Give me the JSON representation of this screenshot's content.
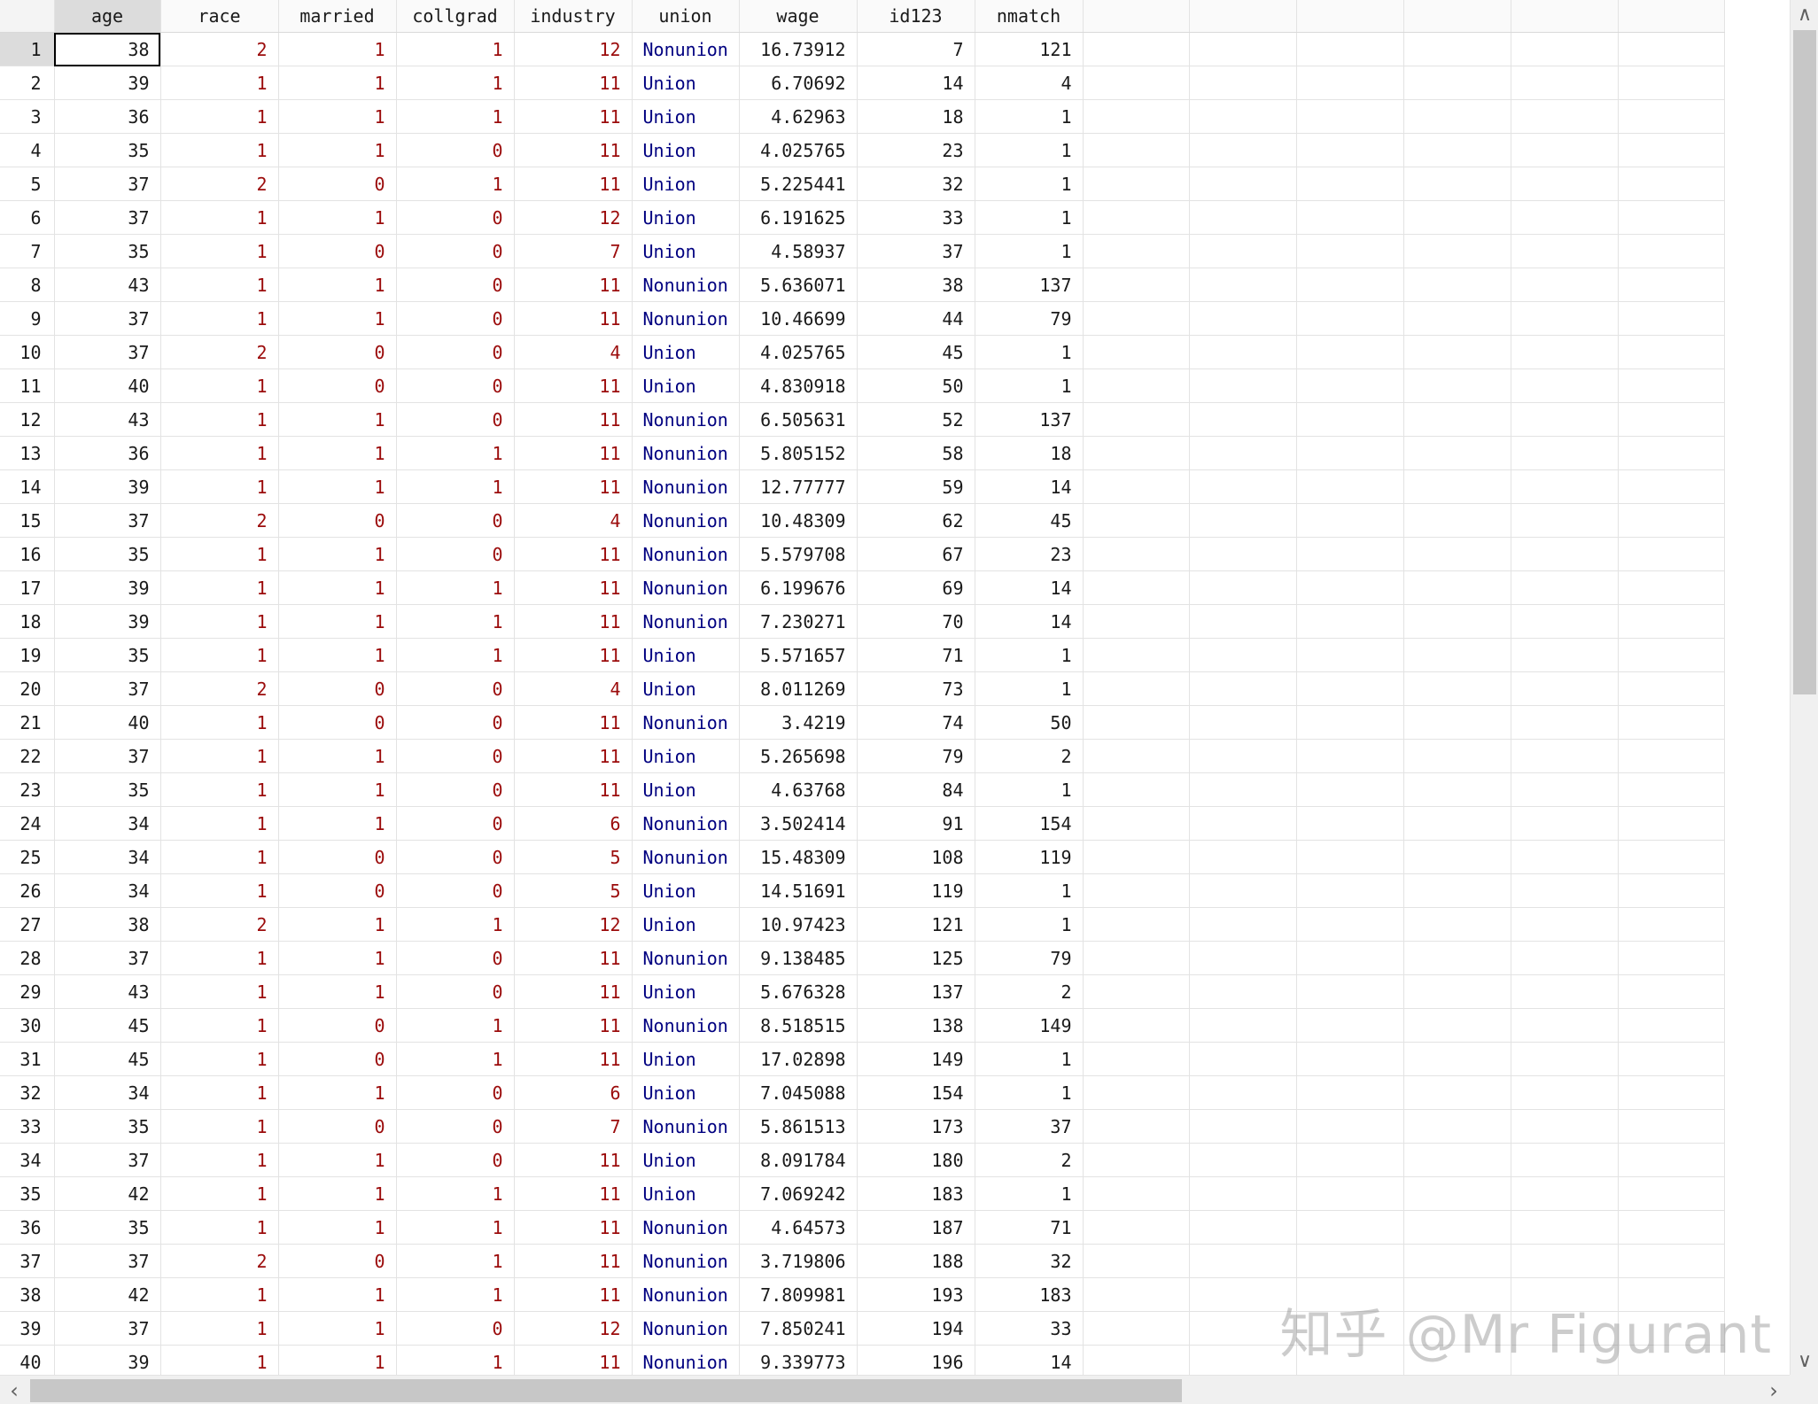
{
  "columns": [
    "age",
    "race",
    "married",
    "collgrad",
    "industry",
    "union",
    "wage",
    "id123",
    "nmatch"
  ],
  "rows": [
    [
      38,
      2,
      1,
      1,
      12,
      "Nonunion",
      "16.73912",
      7,
      121
    ],
    [
      39,
      1,
      1,
      1,
      11,
      "Union",
      "6.70692",
      14,
      4
    ],
    [
      36,
      1,
      1,
      1,
      11,
      "Union",
      "4.62963",
      18,
      1
    ],
    [
      35,
      1,
      1,
      0,
      11,
      "Union",
      "4.025765",
      23,
      1
    ],
    [
      37,
      2,
      0,
      1,
      11,
      "Union",
      "5.225441",
      32,
      1
    ],
    [
      37,
      1,
      1,
      0,
      12,
      "Union",
      "6.191625",
      33,
      1
    ],
    [
      35,
      1,
      0,
      0,
      7,
      "Union",
      "4.58937",
      37,
      1
    ],
    [
      43,
      1,
      1,
      0,
      11,
      "Nonunion",
      "5.636071",
      38,
      137
    ],
    [
      37,
      1,
      1,
      0,
      11,
      "Nonunion",
      "10.46699",
      44,
      79
    ],
    [
      37,
      2,
      0,
      0,
      4,
      "Union",
      "4.025765",
      45,
      1
    ],
    [
      40,
      1,
      0,
      0,
      11,
      "Union",
      "4.830918",
      50,
      1
    ],
    [
      43,
      1,
      1,
      0,
      11,
      "Nonunion",
      "6.505631",
      52,
      137
    ],
    [
      36,
      1,
      1,
      1,
      11,
      "Nonunion",
      "5.805152",
      58,
      18
    ],
    [
      39,
      1,
      1,
      1,
      11,
      "Nonunion",
      "12.77777",
      59,
      14
    ],
    [
      37,
      2,
      0,
      0,
      4,
      "Nonunion",
      "10.48309",
      62,
      45
    ],
    [
      35,
      1,
      1,
      0,
      11,
      "Nonunion",
      "5.579708",
      67,
      23
    ],
    [
      39,
      1,
      1,
      1,
      11,
      "Nonunion",
      "6.199676",
      69,
      14
    ],
    [
      39,
      1,
      1,
      1,
      11,
      "Nonunion",
      "7.230271",
      70,
      14
    ],
    [
      35,
      1,
      1,
      1,
      11,
      "Union",
      "5.571657",
      71,
      1
    ],
    [
      37,
      2,
      0,
      0,
      4,
      "Union",
      "8.011269",
      73,
      1
    ],
    [
      40,
      1,
      0,
      0,
      11,
      "Nonunion",
      "3.4219",
      74,
      50
    ],
    [
      37,
      1,
      1,
      0,
      11,
      "Union",
      "5.265698",
      79,
      2
    ],
    [
      35,
      1,
      1,
      0,
      11,
      "Union",
      "4.63768",
      84,
      1
    ],
    [
      34,
      1,
      1,
      0,
      6,
      "Nonunion",
      "3.502414",
      91,
      154
    ],
    [
      34,
      1,
      0,
      0,
      5,
      "Nonunion",
      "15.48309",
      108,
      119
    ],
    [
      34,
      1,
      0,
      0,
      5,
      "Union",
      "14.51691",
      119,
      1
    ],
    [
      38,
      2,
      1,
      1,
      12,
      "Union",
      "10.97423",
      121,
      1
    ],
    [
      37,
      1,
      1,
      0,
      11,
      "Nonunion",
      "9.138485",
      125,
      79
    ],
    [
      43,
      1,
      1,
      0,
      11,
      "Union",
      "5.676328",
      137,
      2
    ],
    [
      45,
      1,
      0,
      1,
      11,
      "Nonunion",
      "8.518515",
      138,
      149
    ],
    [
      45,
      1,
      0,
      1,
      11,
      "Union",
      "17.02898",
      149,
      1
    ],
    [
      34,
      1,
      1,
      0,
      6,
      "Union",
      "7.045088",
      154,
      1
    ],
    [
      35,
      1,
      0,
      0,
      7,
      "Nonunion",
      "5.861513",
      173,
      37
    ],
    [
      37,
      1,
      1,
      0,
      11,
      "Union",
      "8.091784",
      180,
      2
    ],
    [
      42,
      1,
      1,
      1,
      11,
      "Union",
      "7.069242",
      183,
      1
    ],
    [
      35,
      1,
      1,
      1,
      11,
      "Nonunion",
      "4.64573",
      187,
      71
    ],
    [
      37,
      2,
      0,
      1,
      11,
      "Nonunion",
      "3.719806",
      188,
      32
    ],
    [
      42,
      1,
      1,
      1,
      11,
      "Nonunion",
      "7.809981",
      193,
      183
    ],
    [
      37,
      1,
      1,
      0,
      12,
      "Nonunion",
      "7.850241",
      194,
      33
    ],
    [
      39,
      1,
      1,
      1,
      11,
      "Nonunion",
      "9.339773",
      196,
      14
    ]
  ],
  "value_colors": {
    "numeric": "#1a1a1a",
    "encoded": "#9b0b0b",
    "value_label": "#000080"
  },
  "selected": {
    "row": 1,
    "column": "age"
  },
  "scrollbars": {
    "up_icon": "chevron-up-icon",
    "down_icon": "chevron-down-icon",
    "left_icon": "chevron-left-icon",
    "right_icon": "chevron-right-icon",
    "up": "∧",
    "down": "∨",
    "left": "‹",
    "right": "›"
  },
  "watermark": "知乎 @Mr Figurant"
}
